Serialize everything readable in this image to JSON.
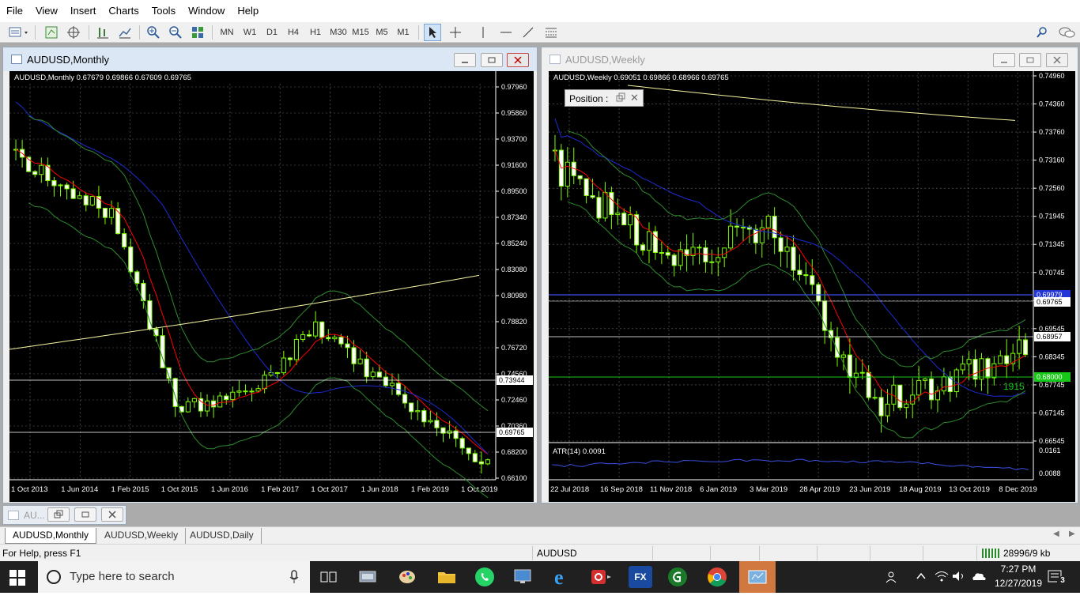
{
  "menu": [
    "File",
    "View",
    "Insert",
    "Charts",
    "Tools",
    "Window",
    "Help"
  ],
  "toolbar": {
    "timeframes": [
      "MN",
      "W1",
      "D1",
      "H4",
      "H1",
      "M30",
      "M15",
      "M5",
      "M1"
    ]
  },
  "windows": {
    "monthly": {
      "title": "AUDUSD,Monthly",
      "ohlc": "AUDUSD,Monthly  0.67679 0.69866 0.67609 0.69765",
      "price_labels": [
        "0.97960",
        "0.95860",
        "0.93700",
        "0.91600",
        "0.89500",
        "0.87340",
        "0.85240",
        "0.83080",
        "0.80980",
        "0.78820",
        "0.76720",
        "0.74560",
        "0.72460",
        "0.70360",
        "0.68200",
        "0.66100"
      ],
      "marker_labels": {
        "line_a": "0.73944",
        "bid": "0.69765"
      },
      "dates": [
        "1 Oct 2013",
        "1 Jun 2014",
        "1 Feb 2015",
        "1 Oct 2015",
        "1 Jun 2016",
        "1 Feb 2017",
        "1 Oct 2017",
        "1 Jun 2018",
        "1 Feb 2019",
        "1 Oct 2019"
      ]
    },
    "weekly": {
      "title": "AUDUSD,Weekly",
      "ohlc": "AUDUSD,Weekly  0.69051 0.69866 0.68966 0.69765",
      "position_panel": "Position :",
      "price_labels": [
        "0.74960",
        "0.74360",
        "0.73760",
        "0.73160",
        "0.72560",
        "0.71945",
        "0.71345",
        "0.70745",
        "0.70145",
        "0.69545",
        "0.68345",
        "0.67745",
        "0.67145",
        "0.66545"
      ],
      "marker_labels": {
        "blue": "0.69979",
        "bid": "0.69765",
        "white": "0.68957",
        "green": "0.68000"
      },
      "green_level_text": "1915",
      "atr_label": "ATR(14) 0.0091",
      "atr_scale": [
        "0.0161",
        "0.0088"
      ],
      "dates": [
        "22 Jul 2018",
        "16 Sep 2018",
        "11 Nov 2018",
        "6 Jan 2019",
        "3 Mar 2019",
        "28 Apr 2019",
        "23 Jun 2019",
        "18 Aug 2019",
        "13 Oct 2019",
        "8 Dec 2019"
      ]
    }
  },
  "minimized": {
    "title": "AU..."
  },
  "tabs": [
    "AUDUSD,Monthly",
    "AUDUSD,Weekly",
    "AUDUSD,Daily"
  ],
  "status": {
    "help": "For Help, press F1",
    "symbol": "AUDUSD",
    "traffic": "28996/9 kb"
  },
  "taskbar": {
    "search_placeholder": "Type here to search",
    "time": "7:27 PM",
    "date": "12/27/2019",
    "notifications": "3",
    "fx_app_label": "FX"
  },
  "colors": {
    "bg": "#000000",
    "candle": "#7CFC00",
    "ma_fast": "#ff0000",
    "ma_slow": "#1e2bd6",
    "ma_long": "#f5f5a0",
    "bands": "#2e8b2e",
    "grid": "#c0c0c0",
    "atr": "#3a4fe0"
  }
}
